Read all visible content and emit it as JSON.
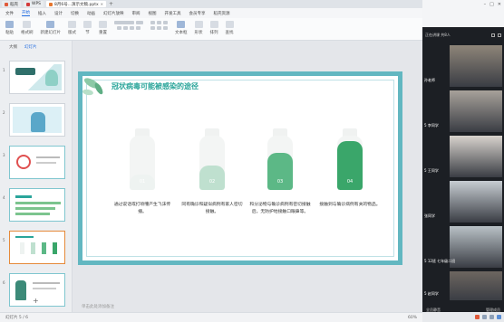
{
  "tabs": [
    {
      "label": "稻壳",
      "active": false,
      "icon_color": "#e05a3a"
    },
    {
      "label": "WPS",
      "active": false,
      "icon_color": "#d33a3a"
    },
    {
      "label": "8月6号...演示文稿.pptx",
      "active": true,
      "icon_color": "#e5762e"
    }
  ],
  "menu": [
    "文件",
    "开始",
    "插入",
    "设计",
    "切换",
    "动画",
    "幻灯片放映",
    "审阅",
    "视图",
    "开发工具",
    "会员专享",
    "稻壳资源"
  ],
  "menu_active": "开始",
  "ribbon": [
    {
      "label": "粘贴",
      "blue": true
    },
    {
      "label": "格式刷",
      "blue": false
    },
    {
      "label": "新建幻灯片",
      "blue": true
    },
    {
      "label": "版式",
      "blue": false
    },
    {
      "label": "节",
      "blue": false
    },
    {
      "label": "重置",
      "blue": false
    },
    {
      "label": "文本框",
      "blue": true
    },
    {
      "label": "形状",
      "blue": false
    },
    {
      "label": "排列",
      "blue": false
    },
    {
      "label": "查找",
      "blue": false
    }
  ],
  "left_panel": {
    "tab_outline": "大纲",
    "tab_slides": "幻灯片",
    "add": "+"
  },
  "thumb_numbers": [
    "1",
    "2",
    "3",
    "4",
    "5",
    "6"
  ],
  "slide": {
    "title": "冠状病毒可能被感染的途径",
    "steps": [
      {
        "num": "01",
        "text": "通过说话或打喷嚏产生飞沫传播。",
        "fill_color": "#eef3f1",
        "fill_frac": 0.28
      },
      {
        "num": "02",
        "text": "同有确诊和疑似病例有家人密切接触。",
        "fill_color": "#bfe0cf",
        "fill_frac": 0.45
      },
      {
        "num": "03",
        "text": "和分泌物与确诊病例有密切接触后，无防护地接触口眼鼻等。",
        "fill_color": "#5cb886",
        "fill_frac": 0.68
      },
      {
        "num": "04",
        "text": "接触到与确诊病例有关的物品。",
        "fill_color": "#3aa66a",
        "fill_frac": 0.9
      }
    ]
  },
  "note_hint": "单击此处添加备注",
  "statusbar": {
    "left": "幻灯片 5 / 6",
    "right": "60%"
  },
  "video_panel": {
    "header": "正在讲课 共8人",
    "tiles": [
      {
        "label": "孙老师",
        "color": "#8e8579"
      },
      {
        "label": "5 李同学",
        "color": "#a7a19a"
      },
      {
        "label": "5 王同学",
        "color": "#d8d3cd"
      },
      {
        "label": "张同学",
        "color": "#c7cdd2"
      },
      {
        "label": "5 12班 七年级二班",
        "color": "#b9c1c6"
      },
      {
        "label": "5 赵同学",
        "color": "#6d6660"
      }
    ],
    "footer_left": "全员静音",
    "footer_right": "管理成员"
  }
}
